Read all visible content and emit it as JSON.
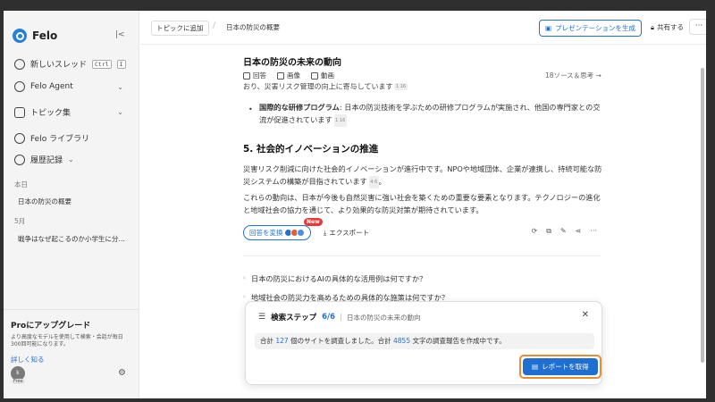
{
  "sidebar": {
    "logo": "Felo",
    "new_thread": "新しいスレッド",
    "shortcut_ctrl": "Ctrl",
    "shortcut_key": "I",
    "agent": "Felo Agent",
    "topics": "トピック集",
    "library": "Felo ライブラリ",
    "history": "履歴記録",
    "today_label": "本日",
    "today_item": "日本の防災の概要",
    "may_label": "5月",
    "may_item": "戦争はなぜ起こるのか小学生に分…",
    "upgrade_title": "Proにアップグレード",
    "upgrade_desc": "より高度なモデルを使用して検索・会話が毎日300回可能になります。",
    "upgrade_link": "詳しく知る",
    "avatar_initial": "k",
    "plan": "Free"
  },
  "topbar": {
    "add_topic": "トピックに追加",
    "breadcrumb_title": "日本の防災の概要",
    "presentation": "プレゼンテーションを生成",
    "share": "共有する",
    "more": "···"
  },
  "main": {
    "question": "日本の防災の未来の動向",
    "tab_answer": "回答",
    "tab_image": "画像",
    "tab_video": "動画",
    "sources": "18ソース＆思考 →",
    "cut_text": "おり、災害リスク管理の向上に寄与しています",
    "bullet_bold": "国際的な研修プログラム",
    "bullet_text": ": 日本の防災技術を学ぶための研修プログラムが実施され、他国の専門家との交流が促進されています",
    "heading": "5. 社会的イノベーションの推進",
    "para1": "災害リスク削減に向けた社会的イノベーションが進行中です。NPOや地域団体、企業が連携し、持続可能な防災システムの構築が目指されています",
    "para2": "これらの動向は、日本が今後も自然災害に強い社会を築くための重要な要素となります。テクノロジーの進化と地域社会の協力を通じて、より効果的な防災対策が期待されています。",
    "convert": "回答を変換",
    "new_badge": "New",
    "export": "エクスポート",
    "related": [
      "日本の防災におけるAIの具体的な活用例は何ですか？",
      "地域社会の防災力を高めるための具体的な施策は何ですか？"
    ]
  },
  "modal": {
    "title": "検索ステップ",
    "progress": "6/6",
    "subtitle": "日本の防災の未来の動向",
    "body_prefix": "合計",
    "sites": "127",
    "body_mid": "個のサイトを調査しました。合計",
    "chars": "4855",
    "body_suffix": "文字の調査報告を作成中です。",
    "report_button": "レポートを取得"
  },
  "colors": {
    "accent": "#2271d1",
    "highlight": "#ee8a2f",
    "new_badge": "#e53935"
  }
}
